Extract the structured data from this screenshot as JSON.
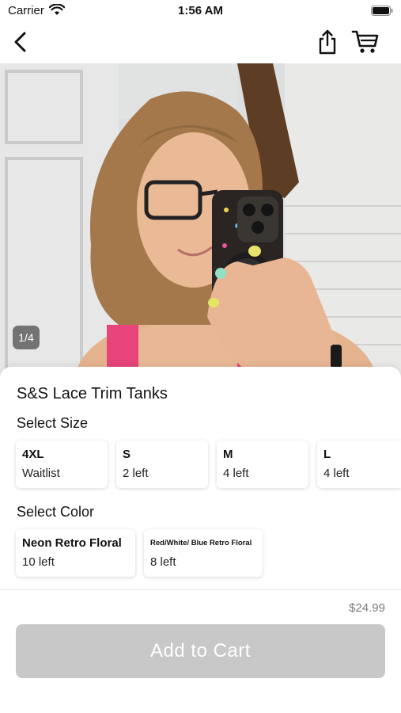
{
  "status_bar": {
    "carrier": "Carrier",
    "time": "1:56 AM"
  },
  "nav": {
    "icons": [
      "chevron-left-icon",
      "share-icon",
      "cart-icon"
    ]
  },
  "gallery": {
    "counter": "1/4"
  },
  "product": {
    "title": "S&S Lace Trim Tanks",
    "size_label": "Select Size",
    "sizes": [
      {
        "name": "4XL",
        "stock": "Waitlist"
      },
      {
        "name": "S",
        "stock": "2 left"
      },
      {
        "name": "M",
        "stock": "4 left"
      },
      {
        "name": "L",
        "stock": "4 left"
      }
    ],
    "color_label": "Select Color",
    "colors": [
      {
        "name": "Neon Retro Floral",
        "stock": "10 left"
      },
      {
        "name": "Red/White/ Blue Retro Floral",
        "stock": "8 left"
      }
    ],
    "price": "$24.99",
    "add_to_cart_label": "Add to Cart"
  },
  "colors": {
    "button_disabled": "#c8c8c8",
    "price_text": "#7a7a7a"
  }
}
